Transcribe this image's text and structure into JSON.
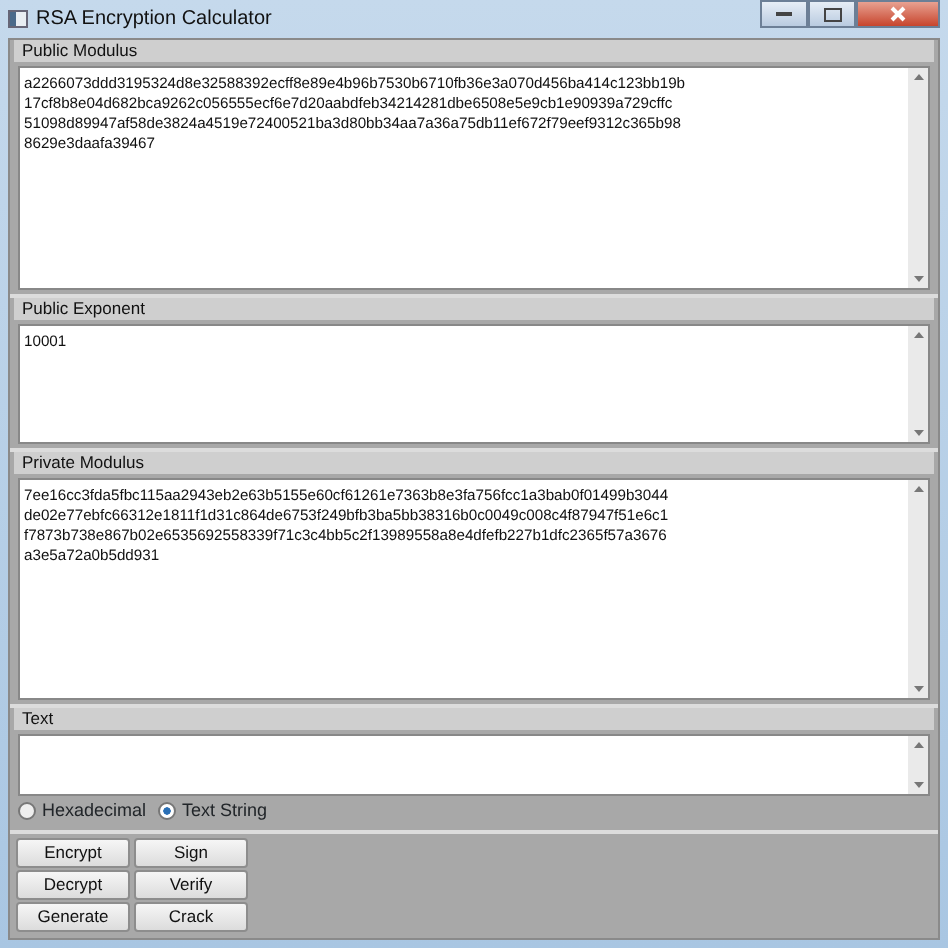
{
  "window": {
    "title": "RSA Encryption Calculator"
  },
  "fields": [
    {
      "label": "Public Modulus",
      "lines": [
        "a2266073ddd3195324d8e32588392ecff8e89e4b96b7530b6710fb36e3a070d456ba414c123bb19b",
        "17cf8b8e04d682bca9262c056555ecf6e7d20aabdfeb34214281dbe6508e5e9cb1e90939a729cffc",
        "51098d89947af58de3824a4519e72400521ba3d80bb34aa7a36a75db11ef672f79eef9312c365b98",
        "8629e3daafa39467"
      ]
    },
    {
      "label": "Public Exponent",
      "lines": [
        "10001"
      ]
    },
    {
      "label": "Private Modulus",
      "lines": [
        "7ee16cc3fda5fbc115aa2943eb2e63b5155e60cf61261e7363b8e3fa756fcc1a3bab0f01499b3044",
        "de02e77ebfc66312e1811f1d31c864de6753f249bfb3ba5bb38316b0c0049c008c4f87947f51e6c1",
        "f7873b738e867b02e6535692558339f71c3c4bb5c2f13989558a8e4dfefb227b1dfc2365f57a3676",
        "a3e5a72a0b5dd931"
      ]
    },
    {
      "label": "Text"
    }
  ],
  "format_options": [
    {
      "label": "Hexadecimal",
      "selected": false
    },
    {
      "label": "Text String",
      "selected": true
    }
  ],
  "buttons": [
    "Encrypt",
    "Sign",
    "Decrypt",
    "Verify",
    "Generate",
    "Crack"
  ]
}
